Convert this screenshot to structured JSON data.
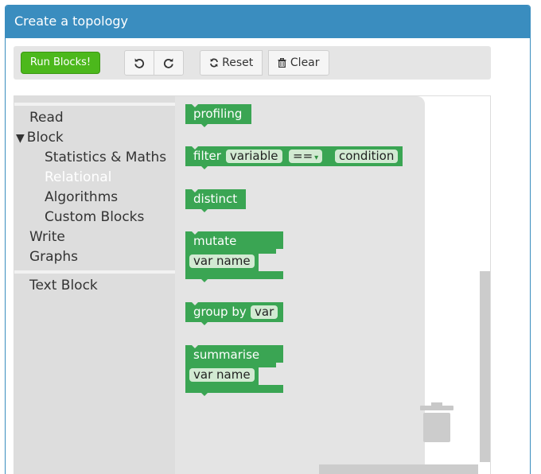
{
  "panel": {
    "title": "Create a topology"
  },
  "toolbar": {
    "run_label": "Run Blocks!",
    "undo_icon": "undo-icon",
    "redo_icon": "redo-icon",
    "reset_label": "Reset",
    "clear_label": "Clear"
  },
  "toolbox": {
    "items": [
      {
        "label": "Read"
      },
      {
        "label": "Block",
        "expanded": true
      },
      {
        "label": "Statistics & Maths"
      },
      {
        "label": "Relational",
        "selected": true
      },
      {
        "label": "Algorithms"
      },
      {
        "label": "Custom Blocks"
      },
      {
        "label": "Write"
      },
      {
        "label": "Graphs"
      },
      {
        "label": "Text Block"
      }
    ],
    "expand_glyph": "▼"
  },
  "flyout": {
    "profiling": {
      "label": "profiling"
    },
    "filter": {
      "label": "filter",
      "variable": "variable",
      "operator": "==",
      "caret": "▾",
      "condition": "condition"
    },
    "distinct": {
      "label": "distinct"
    },
    "mutate": {
      "label": "mutate",
      "var": "var name"
    },
    "group_by": {
      "label": "group by",
      "var": "var"
    },
    "summarise": {
      "label": "summarise",
      "var": "var name"
    }
  },
  "colors": {
    "header": "#3a8dbf",
    "run_button": "#4cb81c",
    "block_green": "#3aa553",
    "toolbox_bg": "#dddddd",
    "flyout_bg": "#e4e4e4"
  }
}
